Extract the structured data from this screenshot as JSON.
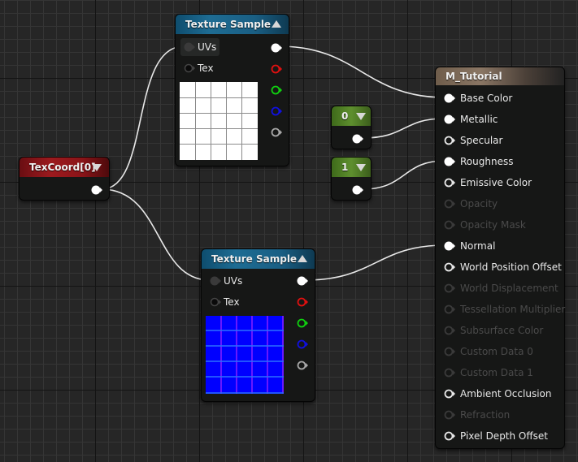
{
  "nodes": {
    "texture_sample_top": {
      "title": "Texture Sample",
      "inputs": [
        {
          "label": "UVs",
          "connected": true
        },
        {
          "label": "Tex",
          "connected": false
        }
      ],
      "outputs": [
        "rgb",
        "r",
        "g",
        "b",
        "a"
      ],
      "preview": "white-grid"
    },
    "texture_sample_bottom": {
      "title": "Texture Sample",
      "inputs": [
        {
          "label": "UVs",
          "connected": true
        },
        {
          "label": "Tex",
          "connected": false
        }
      ],
      "outputs": [
        "rgb",
        "r",
        "g",
        "b",
        "a"
      ],
      "preview": "normal-map-grid"
    },
    "texcoord": {
      "title": "TexCoord[0]"
    },
    "constant_0": {
      "title": "0"
    },
    "constant_1": {
      "title": "1"
    },
    "material": {
      "title": "M_Tutorial",
      "inputs": [
        {
          "label": "Base Color",
          "state": "connected"
        },
        {
          "label": "Metallic",
          "state": "connected"
        },
        {
          "label": "Specular",
          "state": "active"
        },
        {
          "label": "Roughness",
          "state": "connected"
        },
        {
          "label": "Emissive Color",
          "state": "active"
        },
        {
          "label": "Opacity",
          "state": "disabled"
        },
        {
          "label": "Opacity Mask",
          "state": "disabled"
        },
        {
          "label": "Normal",
          "state": "connected"
        },
        {
          "label": "World Position Offset",
          "state": "active"
        },
        {
          "label": "World Displacement",
          "state": "disabled"
        },
        {
          "label": "Tessellation Multiplier",
          "state": "disabled"
        },
        {
          "label": "Subsurface Color",
          "state": "disabled"
        },
        {
          "label": "Custom Data 0",
          "state": "disabled"
        },
        {
          "label": "Custom Data 1",
          "state": "disabled"
        },
        {
          "label": "Ambient Occlusion",
          "state": "active"
        },
        {
          "label": "Refraction",
          "state": "disabled"
        },
        {
          "label": "Pixel Depth Offset",
          "state": "active"
        }
      ]
    }
  },
  "colors": {
    "red_channel": "#e01010",
    "green_channel": "#10d010",
    "blue_channel": "#1010e0",
    "alpha_channel": "#a8a8a8",
    "normal_map_blue": "#0000ff"
  }
}
